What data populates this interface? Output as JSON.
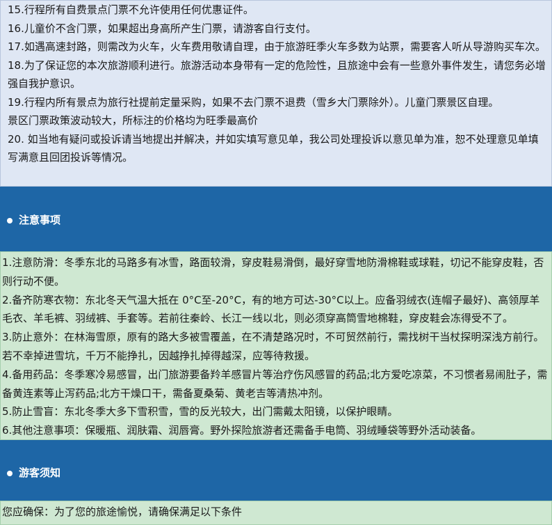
{
  "itinerary_notes": {
    "lines": [
      "15.行程所有自费景点门票不允许使用任何优惠证件。",
      "16.儿童价不含门票，如果超出身高所产生门票，请游客自行支付。",
      "17.如遇高速封路，则需改为火车，火车费用敬请自理，由于旅游旺季火车多数为站票，需要客人听从导游购买车次。",
      "18.为了保证您的本次旅游顺利进行。旅游活动本身带有一定的危险性，且旅途中会有一些意外事件发生，请您务必增强自我护意识。",
      "19.行程内所有景点为旅行社提前定量采购，如果不去门票不退费（雪乡大门票除外）。儿童门票景区自理。",
      "景区门票政策波动较大，所标注的价格均为旺季最高价",
      "20. 如当地有疑问或投诉请当地提出并解决，并如实填写意见单，我公司处理投诉以意见单为准，恕不处理意见单填写满意且回团投诉等情况。"
    ]
  },
  "precautions": {
    "heading": "注意事项",
    "lines": [
      "1.注意防滑：冬季东北的马路多有冰雪，路面较滑，穿皮鞋易滑倒，最好穿雪地防滑棉鞋或球鞋，切记不能穿皮鞋，否则行动不便。",
      "2.备齐防寒衣物：东北冬天气温大抵在 0°C至-20°C，有的地方可达-30°C以上。应备羽绒衣(连帽子最好)、高领厚羊毛衣、羊毛裤、羽绒裤、手套等。若前往秦岭、长江一线以北，则必须穿高筒雪地棉鞋，穿皮鞋会冻得受不了。",
      "3.防止意外：在林海雪原，原有的路大多被雪覆盖，在不清楚路况时，不可贸然前行，需找树干当杖探明深浅方前行。若不幸掉进雪坑，千万不能挣扎，因越挣扎掉得越深，应等待救援。",
      "4.备用药品：冬季寒冷易感冒，出门旅游要备羚羊感冒片等治疗伤风感冒的药品;北方爱吃凉菜，不习惯者易闹肚子，需备黄连素等止泻药品;北方干燥口干，需备夏桑菊、黄老吉等清热冲剂。",
      "5.防止雪盲：东北冬季大多下雪积雪，雪的反光较大，出门需戴太阳镜，以保护眼睛。",
      "6.其他注意事项：保暖瓶、润肤霜、润唇膏。野外探险旅游者还需备手电筒、羽绒睡袋等野外活动装备。"
    ]
  },
  "visitor_notice": {
    "heading": "游客须知",
    "intro": "您应确保：为了您的旅途愉悦，请确保满足以下条件"
  }
}
